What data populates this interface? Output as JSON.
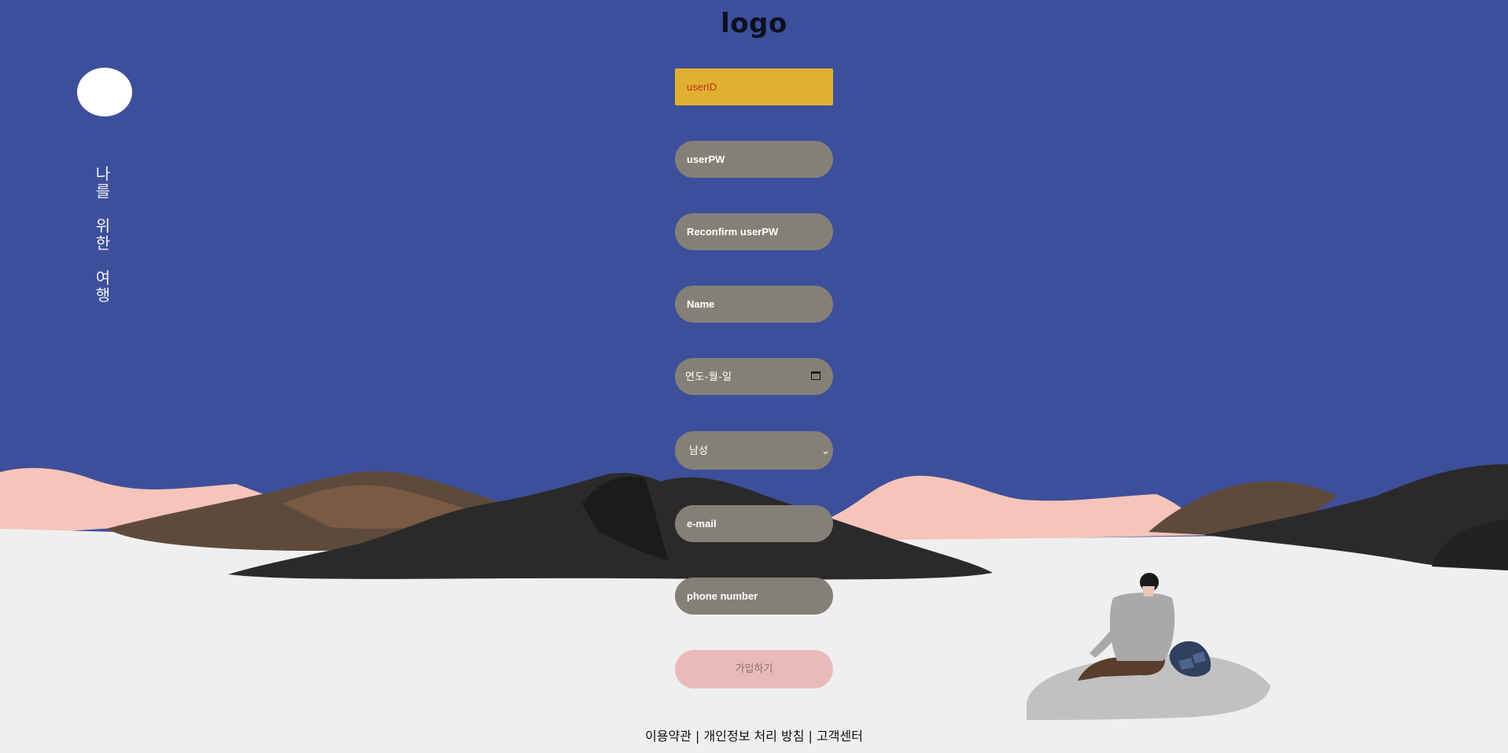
{
  "header": {
    "logo_text": "logo"
  },
  "sidebar": {
    "tagline_lines": [
      [
        "나",
        "를"
      ],
      [
        "위",
        "한"
      ],
      [
        "여",
        "행"
      ]
    ]
  },
  "form": {
    "user_id": {
      "placeholder": "userID"
    },
    "user_pw": {
      "placeholder": "userPW"
    },
    "reconfirm_pw": {
      "placeholder": "Reconfirm userPW"
    },
    "name": {
      "placeholder": "Name"
    },
    "birthdate": {
      "placeholder": "연도-월-일"
    },
    "gender": {
      "selected": "남성"
    },
    "email": {
      "placeholder": "e-mail"
    },
    "phone": {
      "placeholder": "phone number"
    },
    "submit_label": "가입하기"
  },
  "footer": {
    "links": [
      "이용약관",
      "개인정보 처리 방침",
      "고객센터"
    ],
    "separator": " | "
  },
  "colors": {
    "sky": "#3d4f9b",
    "ground": "#efefef",
    "field": "#858077",
    "field_active": "#e1b030",
    "submit": "#eababa",
    "pink_hills": "#f6c4ba"
  }
}
